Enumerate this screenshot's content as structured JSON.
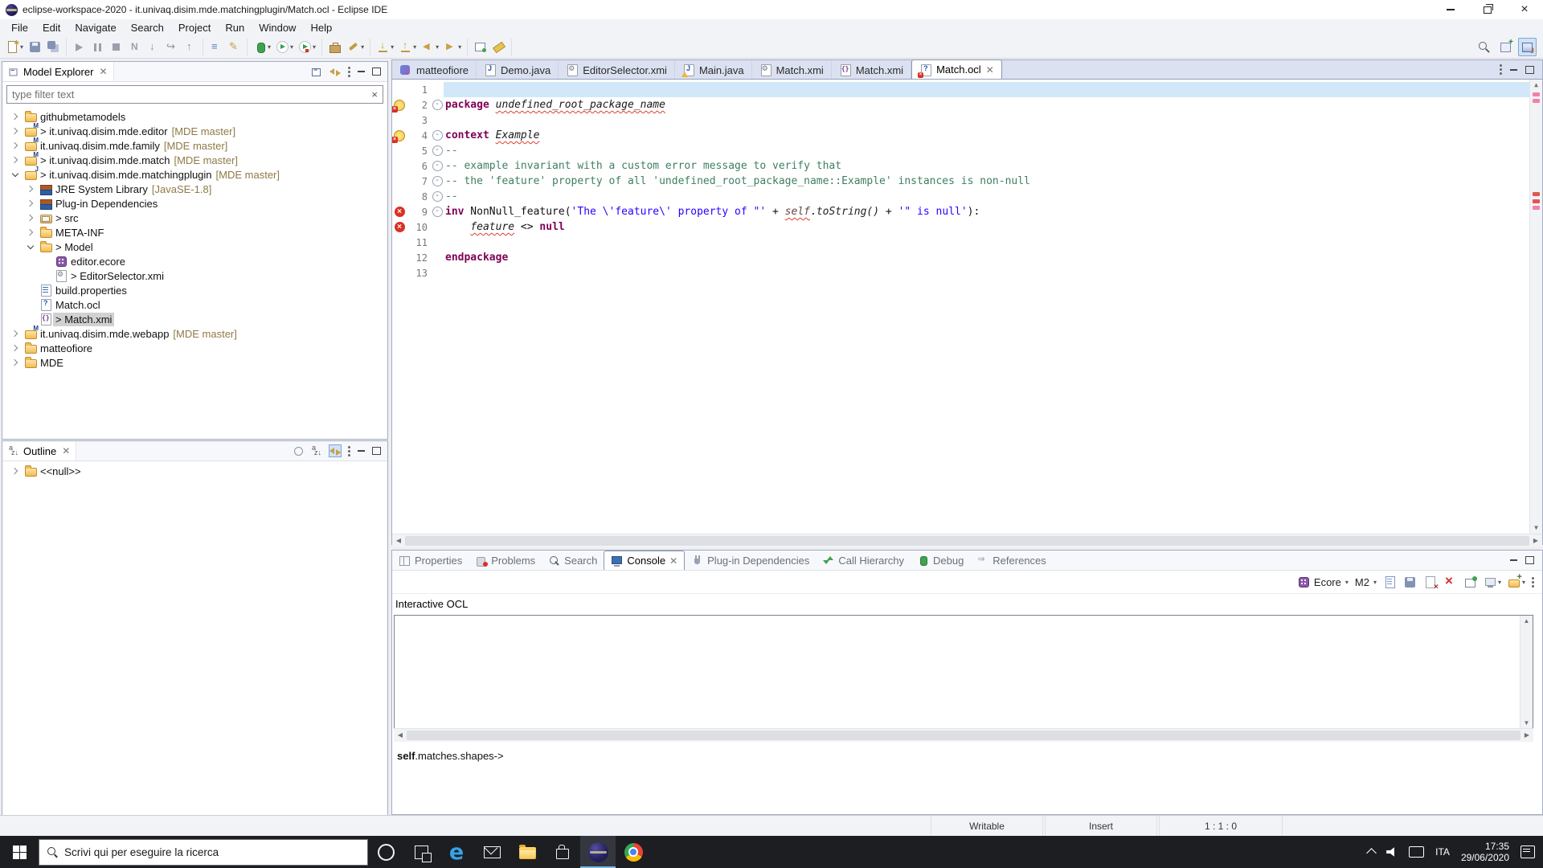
{
  "window": {
    "title": "eclipse-workspace-2020 - it.univaq.disim.mde.matchingplugin/Match.ocl - Eclipse IDE"
  },
  "menu": {
    "items": [
      "File",
      "Edit",
      "Navigate",
      "Search",
      "Project",
      "Run",
      "Window",
      "Help"
    ]
  },
  "toolbar": {
    "groups": [
      [
        {
          "name": "new-wizard",
          "dd": true
        },
        {
          "name": "save"
        },
        {
          "name": "save-all"
        }
      ],
      [
        {
          "name": "debug-resume"
        },
        {
          "name": "debug-suspend"
        },
        {
          "name": "debug-terminate"
        },
        {
          "name": "debug-disconnect"
        },
        {
          "name": "step-into"
        },
        {
          "name": "step-over"
        },
        {
          "name": "step-return"
        }
      ],
      [
        {
          "name": "open-console"
        },
        {
          "name": "external-tools"
        }
      ],
      [
        {
          "name": "debug",
          "dd": true
        },
        {
          "name": "run",
          "dd": true
        },
        {
          "name": "coverage",
          "dd": true
        }
      ],
      [
        {
          "name": "open-toolbox"
        },
        {
          "name": "format-brush",
          "dd": true
        }
      ],
      [
        {
          "name": "import",
          "dd": true
        },
        {
          "name": "export",
          "dd": true
        },
        {
          "name": "back",
          "dd": true
        },
        {
          "name": "forward",
          "dd": true
        }
      ],
      [
        {
          "name": "pin-editor"
        },
        {
          "name": "mark-occurrences"
        }
      ]
    ],
    "right": [
      {
        "name": "search"
      },
      {
        "name": "open-perspective"
      },
      {
        "name": "java-perspective",
        "active": true
      }
    ]
  },
  "model_explorer": {
    "title": "Model Explorer",
    "filter_text": "type filter text",
    "tree": [
      {
        "d": 0,
        "exp": "col",
        "icon": "folder",
        "label": "githubmetamodels"
      },
      {
        "d": 0,
        "exp": "col",
        "icon": "project",
        "label": "> it.univaq.disim.mde.editor",
        "dec": "[MDE master]"
      },
      {
        "d": 0,
        "exp": "col",
        "icon": "project",
        "label": "it.univaq.disim.mde.family",
        "dec": "[MDE master]"
      },
      {
        "d": 0,
        "exp": "col",
        "icon": "project",
        "label": "> it.univaq.disim.mde.match",
        "dec": "[MDE master]"
      },
      {
        "d": 0,
        "exp": "open",
        "icon": "project-java",
        "label": "> it.univaq.disim.mde.matchingplugin",
        "dec": "[MDE master]"
      },
      {
        "d": 1,
        "exp": "col",
        "icon": "library",
        "label": "JRE System Library",
        "dec": "[JavaSE-1.8]"
      },
      {
        "d": 1,
        "exp": "col",
        "icon": "library",
        "label": "Plug-in Dependencies"
      },
      {
        "d": 1,
        "exp": "col",
        "icon": "src",
        "label": "> src"
      },
      {
        "d": 1,
        "exp": "col",
        "icon": "folder",
        "label": "META-INF"
      },
      {
        "d": 1,
        "exp": "open",
        "icon": "folder",
        "label": "> Model"
      },
      {
        "d": 2,
        "exp": "none",
        "icon": "ecore",
        "label": "editor.ecore"
      },
      {
        "d": 2,
        "exp": "none",
        "icon": "xmi",
        "label": "> EditorSelector.xmi"
      },
      {
        "d": 1,
        "exp": "none",
        "icon": "properties",
        "label": "build.properties"
      },
      {
        "d": 1,
        "exp": "none",
        "icon": "ocl",
        "label": "Match.ocl"
      },
      {
        "d": 1,
        "exp": "none",
        "icon": "xmi-json",
        "label": "> Match.xmi",
        "selected": true
      },
      {
        "d": 0,
        "exp": "col",
        "icon": "project",
        "label": "it.univaq.disim.mde.webapp",
        "dec": "[MDE master]"
      },
      {
        "d": 0,
        "exp": "col",
        "icon": "folder",
        "label": "matteofiore"
      },
      {
        "d": 0,
        "exp": "col",
        "icon": "folder",
        "label": "MDE"
      }
    ]
  },
  "outline": {
    "title": "Outline",
    "items": [
      {
        "label": "<<null>>",
        "icon": "folder",
        "exp": "col"
      }
    ]
  },
  "editor": {
    "tabs": [
      {
        "label": "matteofiore",
        "icon": "model-tab"
      },
      {
        "label": "Demo.java",
        "icon": "java"
      },
      {
        "label": "EditorSelector.xmi",
        "icon": "xmi"
      },
      {
        "label": "Main.java",
        "icon": "java",
        "overlay": "warn"
      },
      {
        "label": "Match.xmi",
        "icon": "xmi"
      },
      {
        "label": "Match.xmi",
        "icon": "xmi-json"
      },
      {
        "label": "Match.ocl",
        "icon": "ocl",
        "overlay": "err",
        "active": true,
        "closable": true
      }
    ],
    "lines": [
      {
        "n": "1",
        "fold": false,
        "marker": "",
        "current": true,
        "tokens": []
      },
      {
        "n": "2",
        "fold": true,
        "marker": "warn",
        "tokens": [
          {
            "y": "kw",
            "t": "package"
          },
          {
            "y": "pl",
            "t": " "
          },
          {
            "y": "id",
            "t": "undefined_root_package_name"
          }
        ]
      },
      {
        "n": "3",
        "fold": false,
        "marker": "",
        "tokens": []
      },
      {
        "n": "4",
        "fold": true,
        "marker": "warn",
        "tokens": [
          {
            "y": "kw",
            "t": "context"
          },
          {
            "y": "pl",
            "t": " "
          },
          {
            "y": "id",
            "t": "Example"
          }
        ]
      },
      {
        "n": "5",
        "fold": true,
        "marker": "",
        "tokens": [
          {
            "y": "cm",
            "t": "--"
          }
        ]
      },
      {
        "n": "6",
        "fold": true,
        "marker": "",
        "tokens": [
          {
            "y": "cm",
            "t": "-- example invariant with a custom error message to verify that"
          }
        ]
      },
      {
        "n": "7",
        "fold": true,
        "marker": "",
        "tokens": [
          {
            "y": "cm",
            "t": "-- the 'feature' property of all 'undefined_root_package_name::Example' instances is non-null"
          }
        ]
      },
      {
        "n": "8",
        "fold": true,
        "marker": "",
        "tokens": [
          {
            "y": "cm",
            "t": "--"
          }
        ]
      },
      {
        "n": "9",
        "fold": true,
        "marker": "err",
        "tokens": [
          {
            "y": "kw",
            "t": "inv"
          },
          {
            "y": "pl",
            "t": " NonNull_feature("
          },
          {
            "y": "st",
            "t": "'The \\'feature\\' property of \"'"
          },
          {
            "y": "pl",
            "t": " + "
          },
          {
            "y": "self",
            "t": "self"
          },
          {
            "y": "pl",
            "t": "."
          },
          {
            "y": "mth",
            "t": "toString()"
          },
          {
            "y": "pl",
            "t": " + "
          },
          {
            "y": "st",
            "t": "'\" is null'"
          },
          {
            "y": "pl",
            "t": "):"
          }
        ]
      },
      {
        "n": "10",
        "fold": false,
        "marker": "err",
        "tokens": [
          {
            "y": "pl",
            "t": "\t"
          },
          {
            "y": "id",
            "t": "feature"
          },
          {
            "y": "pl",
            "t": " <> "
          },
          {
            "y": "kw",
            "t": "null"
          }
        ]
      },
      {
        "n": "11",
        "fold": false,
        "marker": "",
        "tokens": []
      },
      {
        "n": "12",
        "fold": false,
        "marker": "",
        "tokens": [
          {
            "y": "kw",
            "t": "endpackage"
          }
        ]
      },
      {
        "n": "13",
        "fold": false,
        "marker": "",
        "tokens": []
      }
    ]
  },
  "console": {
    "tabs": [
      {
        "label": "Properties",
        "icon": "properties"
      },
      {
        "label": "Problems",
        "icon": "problems"
      },
      {
        "label": "Search",
        "icon": "search"
      },
      {
        "label": "Console",
        "icon": "console",
        "active": true,
        "closable": true
      },
      {
        "label": "Plug-in Dependencies",
        "icon": "plugin"
      },
      {
        "label": "Call Hierarchy",
        "icon": "call"
      },
      {
        "label": "Debug",
        "icon": "debug"
      },
      {
        "label": "References",
        "icon": "references"
      }
    ],
    "toolbar": {
      "ecore_label": "Ecore",
      "m2_label": "M2",
      "icons": [
        "new-file",
        "save-console",
        "clear-console",
        "remove-launches",
        "pin-console",
        "display-console",
        "open-console-new",
        "view-menu"
      ]
    },
    "section_label": "Interactive OCL",
    "preview": {
      "emphasis": "self",
      "rest": ".matches.shapes->"
    }
  },
  "status": {
    "writable": "Writable",
    "input_mode": "Insert",
    "caret_position": "1 : 1 : 0"
  },
  "taskbar": {
    "search_placeholder": "Scrivi qui per eseguire la ricerca",
    "apps": [
      "cortana",
      "task-view",
      "edge",
      "mail",
      "file-explorer",
      "store",
      "eclipse",
      "chrome"
    ],
    "active_app": "eclipse",
    "tray": {
      "lang": "ITA",
      "time": "17:35",
      "date": "29/06/2020"
    }
  }
}
